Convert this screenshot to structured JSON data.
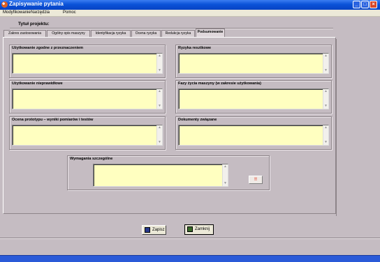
{
  "window": {
    "title": "Zapisywanie pytania",
    "minimize": "_",
    "maximize": "□",
    "close": "×"
  },
  "menu": {
    "items": [
      "Modyfikowanie",
      "Narzędzia",
      "Pomoc"
    ]
  },
  "project": {
    "label": "Tytuł projektu:"
  },
  "tabs": [
    {
      "label": "Zakres zastosowania",
      "active": false
    },
    {
      "label": "Ogólny opis maszyny",
      "active": false
    },
    {
      "label": "Identyfikacja ryzyka",
      "active": false
    },
    {
      "label": "Ocena ryzyka",
      "active": false
    },
    {
      "label": "Redukcja ryzyka",
      "active": false
    },
    {
      "label": "Podsumowanie",
      "active": true
    }
  ],
  "groups": {
    "intended_use": {
      "label": "Użytkowanie zgodne z przeznaczeniem",
      "value": ""
    },
    "risks_excluded": {
      "label": "Ryzyka resztkowe",
      "value": ""
    },
    "misuse": {
      "label": "Użytkowanie nieprawidłowe",
      "value": ""
    },
    "lifecycle": {
      "label": "Fazy życia maszyny (w zakresie użytkowania)",
      "value": ""
    },
    "prototype_eval": {
      "label": "Ocena prototypu – wyniki pomiarów i testów",
      "value": ""
    },
    "documents": {
      "label": "Dokumenty związane",
      "value": ""
    },
    "requirements": {
      "label": "Wymagania szczególne",
      "value": ""
    }
  },
  "icons": {
    "scroll_up": "▲",
    "scroll_down": "▼",
    "small_button": "!!"
  },
  "buttons": {
    "save": "Zapisz",
    "close": "Zamknij"
  },
  "colors": {
    "field_bg": "#ffffc0",
    "client_bg": "#c5bcc2",
    "titlebar": "#0a52d8"
  }
}
